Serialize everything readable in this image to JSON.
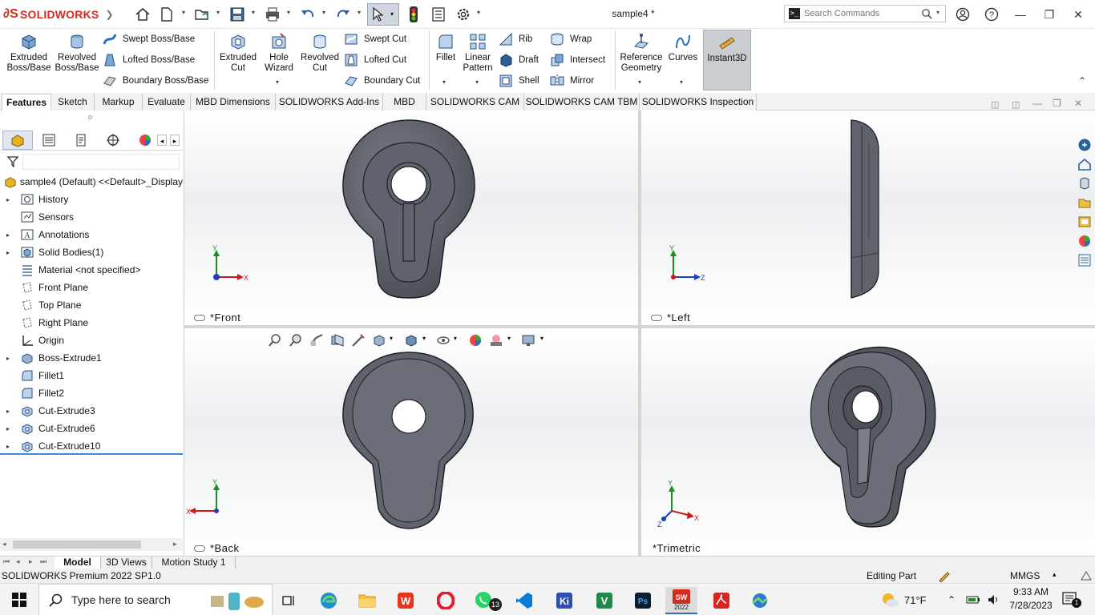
{
  "app": {
    "brand": "SOLIDWORKS",
    "document_title": "sample4 *"
  },
  "search": {
    "placeholder": "Search Commands"
  },
  "titlebar_icons": [
    "home-icon",
    "new-document-icon",
    "open-folder-icon",
    "save-icon",
    "print-icon",
    "undo-icon",
    "redo-icon",
    "select-arrow-icon",
    "traffic-light-icon",
    "file-properties-icon",
    "options-gear-icon"
  ],
  "ribbon": {
    "extruded_boss": "Extruded\nBoss/Base",
    "revolved_boss": "Revolved\nBoss/Base",
    "swept_boss": "Swept Boss/Base",
    "lofted_boss": "Lofted Boss/Base",
    "boundary_boss": "Boundary Boss/Base",
    "extruded_cut": "Extruded\nCut",
    "hole_wizard": "Hole\nWizard",
    "revolved_cut": "Revolved\nCut",
    "swept_cut": "Swept Cut",
    "lofted_cut": "Lofted Cut",
    "boundary_cut": "Boundary Cut",
    "fillet": "Fillet",
    "linear_pattern": "Linear\nPattern",
    "rib": "Rib",
    "draft": "Draft",
    "shell": "Shell",
    "wrap": "Wrap",
    "intersect": "Intersect",
    "mirror": "Mirror",
    "reference_geometry": "Reference\nGeometry",
    "curves": "Curves",
    "instant3d": "Instant3D"
  },
  "cm_tabs": [
    "Features",
    "Sketch",
    "Markup",
    "Evaluate",
    "MBD Dimensions",
    "SOLIDWORKS Add-Ins",
    "MBD",
    "SOLIDWORKS CAM",
    "SOLIDWORKS CAM TBM",
    "SOLIDWORKS Inspection"
  ],
  "feature_tree": {
    "root": "sample4 (Default) <<Default>_Display",
    "items": [
      {
        "label": "History",
        "icon": "history-folder-icon"
      },
      {
        "label": "Sensors",
        "icon": "sensors-icon"
      },
      {
        "label": "Annotations",
        "icon": "annotations-icon"
      },
      {
        "label": "Solid Bodies(1)",
        "icon": "solid-bodies-icon"
      },
      {
        "label": "Material <not specified>",
        "icon": "material-icon"
      },
      {
        "label": "Front Plane",
        "icon": "plane-icon"
      },
      {
        "label": "Top Plane",
        "icon": "plane-icon"
      },
      {
        "label": "Right Plane",
        "icon": "plane-icon"
      },
      {
        "label": "Origin",
        "icon": "origin-icon"
      },
      {
        "label": "Boss-Extrude1",
        "icon": "boss-extrude-icon"
      },
      {
        "label": "Fillet1",
        "icon": "fillet-icon"
      },
      {
        "label": "Fillet2",
        "icon": "fillet-icon"
      },
      {
        "label": "Cut-Extrude3",
        "icon": "cut-extrude-icon"
      },
      {
        "label": "Cut-Extrude6",
        "icon": "cut-extrude-icon"
      },
      {
        "label": "Cut-Extrude10",
        "icon": "cut-extrude-icon"
      }
    ]
  },
  "viewports": {
    "front": "*Front",
    "left": "*Left",
    "back": "*Back",
    "trimetric": "*Trimetric",
    "axis_x": "X",
    "axis_y": "Y",
    "axis_z": "Z"
  },
  "bottom_tabs": [
    "Model",
    "3D Views",
    "Motion Study 1"
  ],
  "status": {
    "product": "SOLIDWORKS Premium 2022 SP1.0",
    "mode": "Editing Part",
    "units": "MMGS"
  },
  "taskbar": {
    "search_placeholder": "Type here to search",
    "whatsapp_badge": "13",
    "sw_label": "2022",
    "weather": "71°F",
    "time": "9:33 AM",
    "date": "7/28/2023",
    "notifications": "1"
  },
  "colors": {
    "accent": "#d52b1e",
    "part_gray": "#5f636d",
    "selection": "#cfd6e0"
  }
}
